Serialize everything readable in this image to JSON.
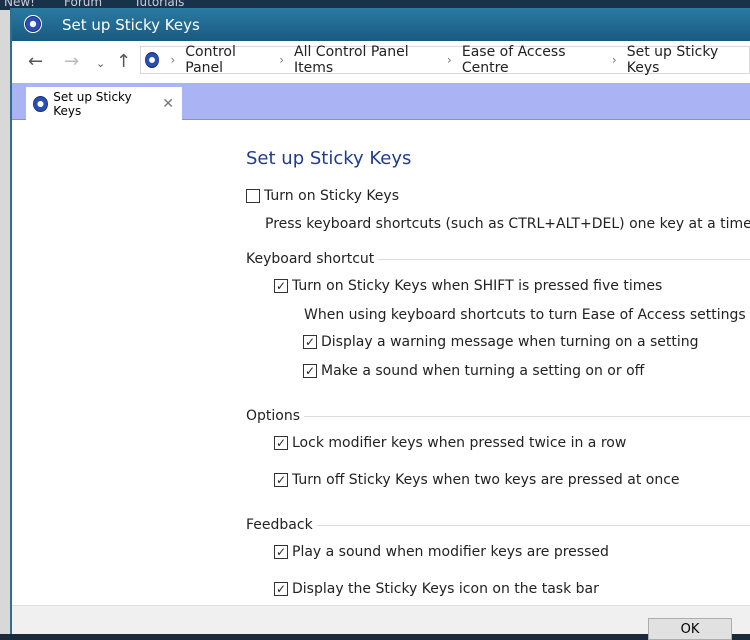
{
  "background": {
    "nav": [
      "New!",
      "Forum",
      "Tutorials"
    ]
  },
  "window": {
    "title": "Set up Sticky Keys"
  },
  "address": {
    "breadcrumbs": [
      "Control Panel",
      "All Control Panel Items",
      "Ease of Access Centre",
      "Set up Sticky Keys"
    ]
  },
  "tab": {
    "label": "Set up Sticky Keys"
  },
  "main": {
    "heading": "Set up Sticky Keys",
    "turn_on": {
      "label": "Turn on Sticky Keys",
      "checked": false
    },
    "turn_on_desc": "Press keyboard shortcuts (such as CTRL+ALT+DEL) one key at a time.",
    "keyboard_shortcut": {
      "title": "Keyboard shortcut",
      "shift": {
        "label": "Turn on Sticky Keys when SHIFT is pressed five times",
        "checked": true
      },
      "sub_desc": "When using keyboard shortcuts to turn Ease of Access settings on:",
      "warning": {
        "label": "Display a warning message when turning on a setting",
        "checked": true
      },
      "sound": {
        "label": "Make a sound when turning a setting on or off",
        "checked": true
      }
    },
    "options": {
      "title": "Options",
      "lock": {
        "label": "Lock modifier keys when pressed twice in a row",
        "checked": true
      },
      "turnoff": {
        "label": "Turn off Sticky Keys when two keys are pressed at once",
        "checked": true
      }
    },
    "feedback": {
      "title": "Feedback",
      "play": {
        "label": "Play a sound when modifier keys are pressed",
        "checked": true
      },
      "icon": {
        "label": "Display the Sticky Keys icon on the task bar",
        "checked": true
      }
    }
  },
  "footer": {
    "ok": "OK"
  }
}
